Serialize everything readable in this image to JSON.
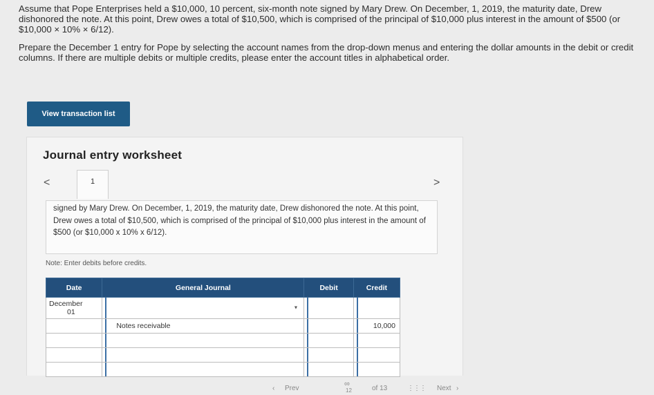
{
  "problem": {
    "paragraph1": "Assume that Pope Enterprises held a $10,000, 10 percent, six-month note signed by Mary Drew. On December, 1, 2019, the maturity date, Drew dishonored the note. At this point, Drew owes a total of $10,500, which is comprised of the principal of $10,000 plus interest in the amount of $500 (or $10,000 × 10% × 6/12).",
    "paragraph2": "Prepare the December 1 entry for Pope by selecting the account names from the drop-down menus and entering the dollar amounts in the debit or credit columns. If there are multiple debits or multiple credits, please enter the account titles in alphabetical order."
  },
  "view_button_label": "View transaction list",
  "worksheet": {
    "title": "Journal entry worksheet",
    "nav_prev": "<",
    "nav_next": ">",
    "tab_label": "1",
    "description": "signed by Mary Drew. On December, 1, 2019, the maturity date, Drew dishonored the note. At this point, Drew owes a total of $10,500, which is comprised of the principal of $10,000 plus interest in the amount of $500 (or $10,000 x 10% x 6/12).",
    "note": "Note: Enter debits before credits."
  },
  "journal": {
    "headers": [
      "Date",
      "General Journal",
      "Debit",
      "Credit"
    ],
    "rows": [
      {
        "date_line1": "December",
        "date_line2": "01",
        "account": "",
        "debit": "",
        "credit": ""
      },
      {
        "date_line1": "",
        "date_line2": "",
        "account": "Notes receivable",
        "debit": "",
        "credit": "10,000"
      },
      {
        "date_line1": "",
        "date_line2": "",
        "account": "",
        "debit": "",
        "credit": ""
      },
      {
        "date_line1": "",
        "date_line2": "",
        "account": "",
        "debit": "",
        "credit": ""
      },
      {
        "date_line1": "",
        "date_line2": "",
        "account": "",
        "debit": "",
        "credit": ""
      }
    ]
  },
  "bottom": {
    "prev": "Prev",
    "page": "of 13",
    "page_current": "12",
    "next": "Next"
  }
}
